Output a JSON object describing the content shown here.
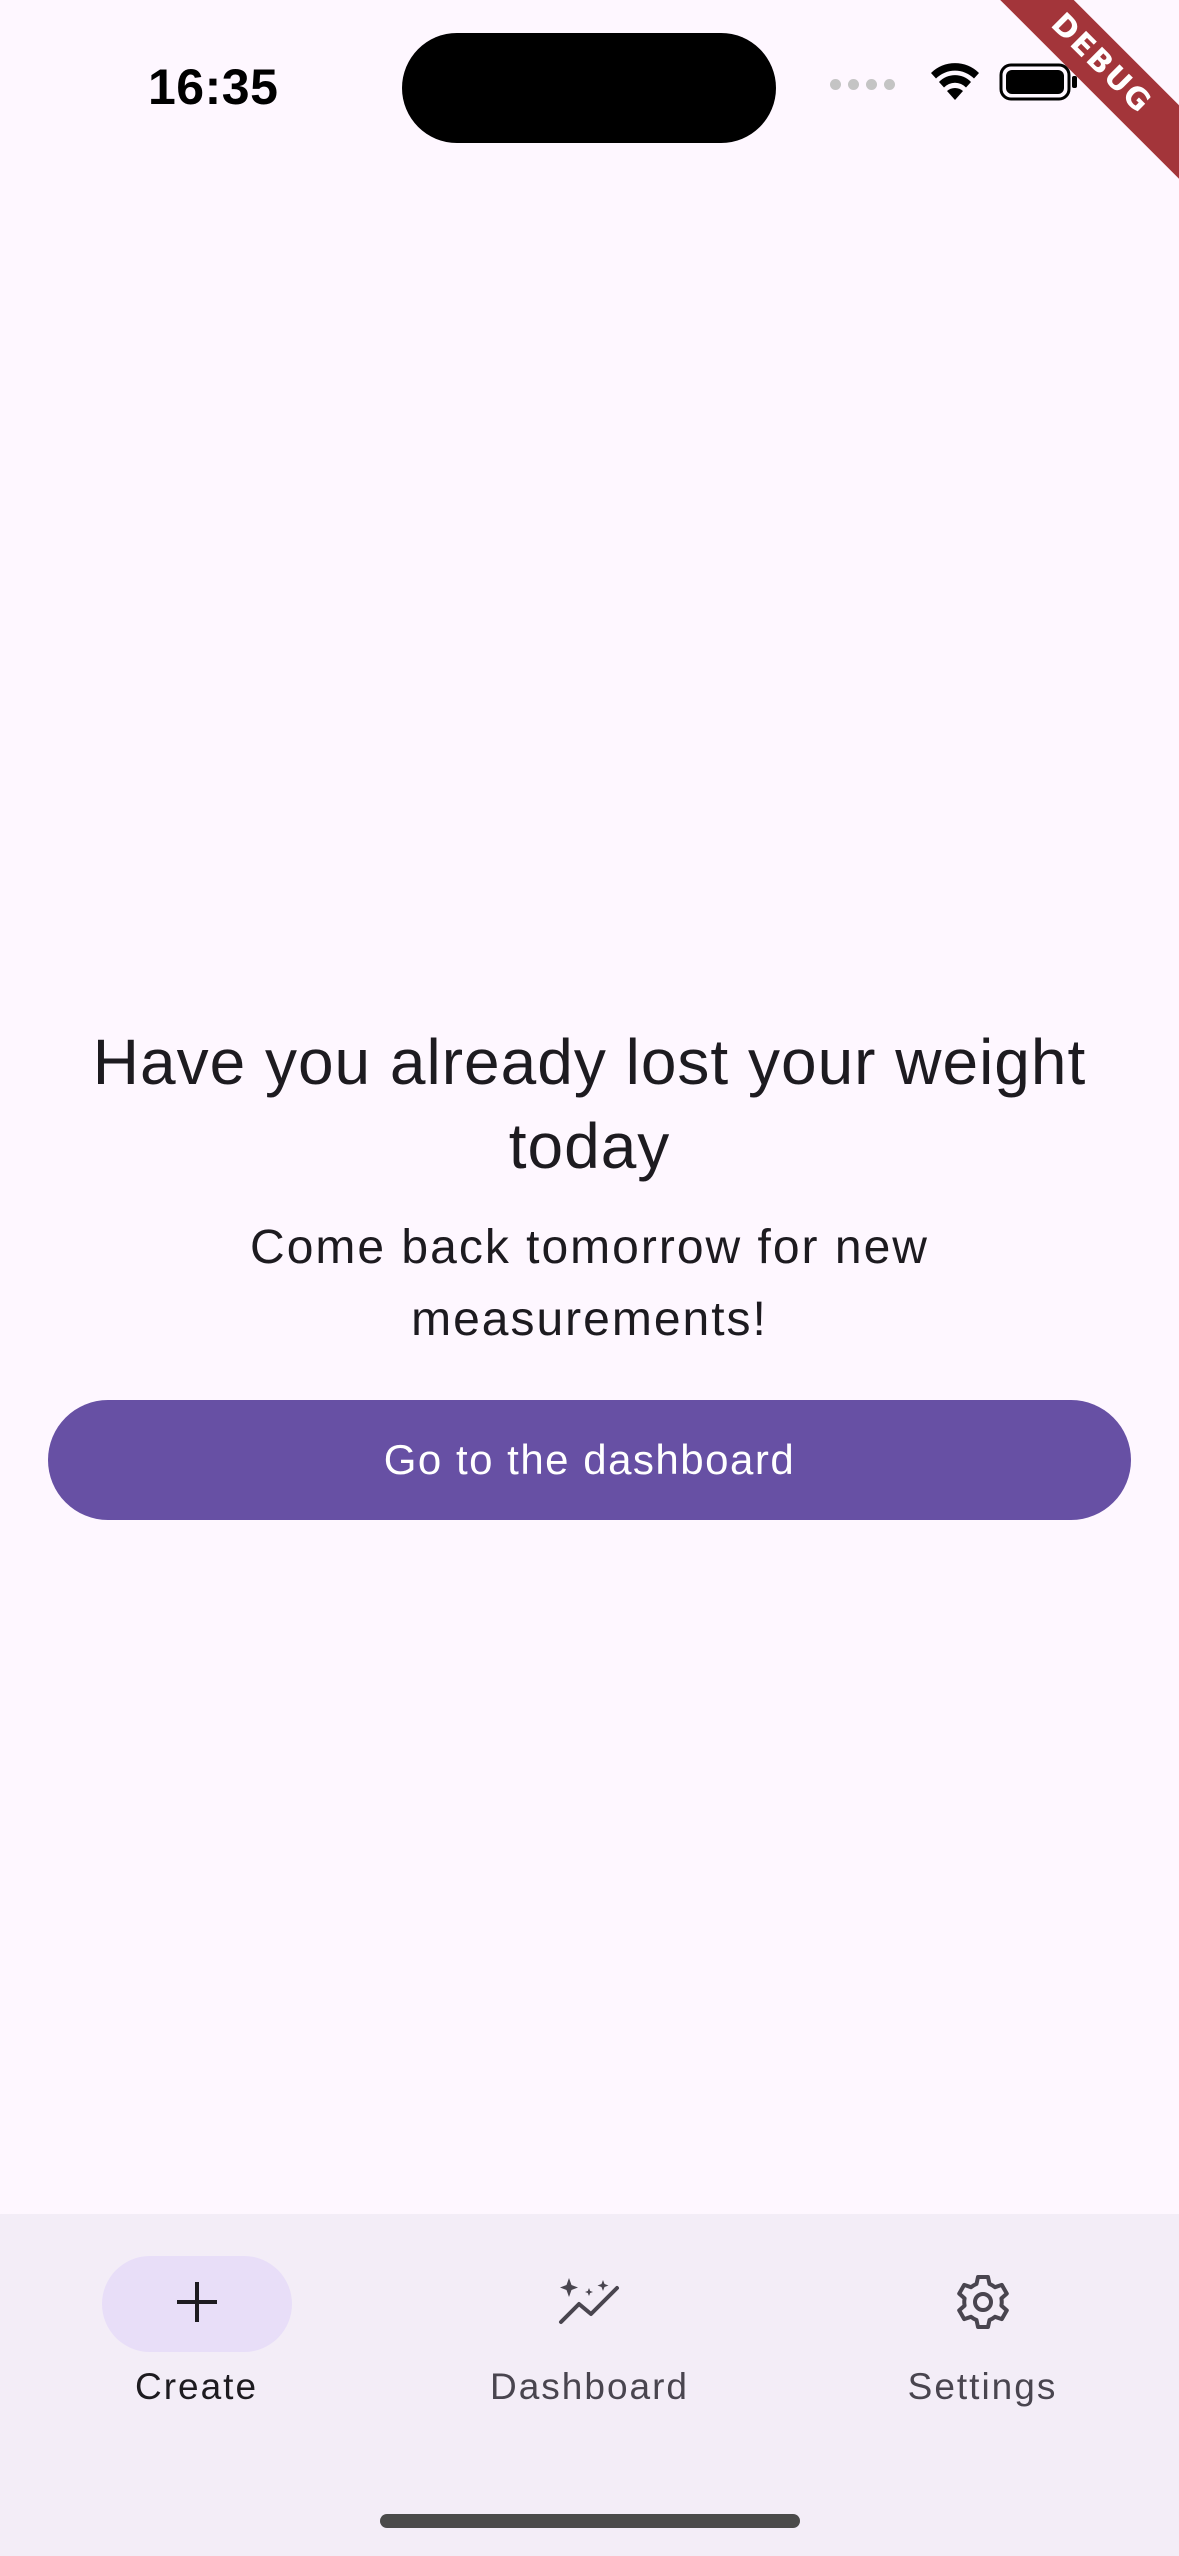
{
  "status_bar": {
    "time": "16:35",
    "debug_label": "DEBUG"
  },
  "main": {
    "headline": "Have you already lost your weight today",
    "subtitle": "Come back tomorrow for new measurements!",
    "dashboard_button_label": "Go to the dashboard"
  },
  "bottom_nav": {
    "items": [
      {
        "label": "Create",
        "icon": "plus-icon",
        "active": true
      },
      {
        "label": "Dashboard",
        "icon": "insights-icon",
        "active": false
      },
      {
        "label": "Settings",
        "icon": "gear-icon",
        "active": false
      }
    ]
  },
  "colors": {
    "background": "#fef7ff",
    "primary": "#6750a4",
    "nav_background": "#f3edf7",
    "nav_active_indicator": "#e8def8",
    "debug_banner": "#a3353a"
  }
}
